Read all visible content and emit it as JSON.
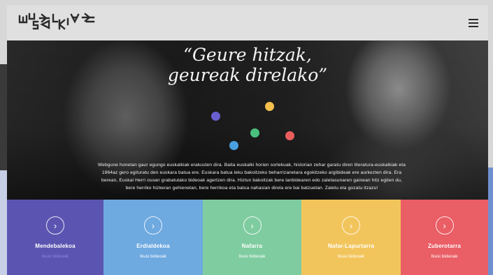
{
  "header": {
    "logo_text": "EUSKALKIAK",
    "menu_icon": "hamburger-icon"
  },
  "hero": {
    "quote_line1": "“Geure hitzak,",
    "quote_line2": "geureak direlako”",
    "intro": "Webgune honetan gaur egungo euskalkiak erakusten dira. Baita euskalki horien sorlekuak, historian zehar garatu diren literatura-euskalkiak eta 1964az gero egituratu den euskara batua ere. Euskara batua leku bakoitzeko beharrizanetara egokitzeko argibideak ere aurkezten dira. Era berean, Euskal Herri osoan grabatutako bideoak agertzen dira. Hiztun bakoitzak bere lanbidearen edo zaletasunaren gainean hitz egiten du, bere herriko hizkeran gehienetan, bere herrikoa eta batua nahasian direla ere bai batzuetan. Zaletu eta gozatu itzazu!",
    "dot_colors": [
      "#6a5fd0",
      "#f4c04d",
      "#49c07d",
      "#4a9fe0",
      "#ea5d5d"
    ]
  },
  "regions": [
    {
      "name": "Mendebalekoa",
      "link": "Ikusi bideoak",
      "color": "#5b55b1",
      "link_color": "#8f86dc"
    },
    {
      "name": "Erdialdekoa",
      "link": "Ikusi bideoak",
      "color": "#6ea9e0",
      "link_color": "#ffffff"
    },
    {
      "name": "Nafarra",
      "link": "Ikusi bideoak",
      "color": "#7fcca0",
      "link_color": "#ffffff"
    },
    {
      "name": "Nafar-Lapurtarra",
      "link": "Ikusi bideoak",
      "color": "#f2c55c",
      "link_color": "#ffffff"
    },
    {
      "name": "Zuberotarra",
      "link": "Ikusi bideoak",
      "color": "#ea5e66",
      "link_color": "#ffffff"
    }
  ]
}
